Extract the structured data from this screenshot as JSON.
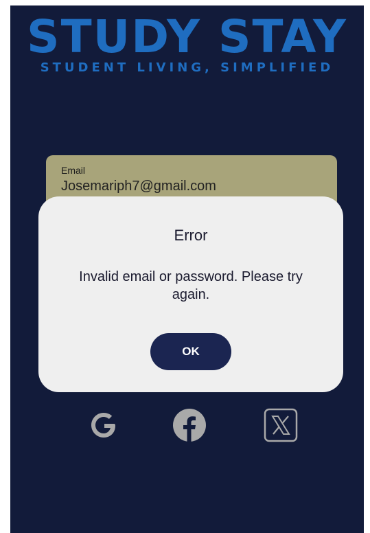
{
  "brand": {
    "title": "STUDY STAY",
    "tagline": "STUDENT LIVING, SIMPLIFIED"
  },
  "email_field": {
    "label": "Email",
    "value": "Josemariph7@gmail.com"
  },
  "dialog": {
    "title": "Error",
    "message": "Invalid email or password. Please try again.",
    "ok_label": "OK"
  },
  "social": {
    "items": [
      {
        "name": "google",
        "icon": "google-icon"
      },
      {
        "name": "facebook",
        "icon": "facebook-icon"
      },
      {
        "name": "x",
        "icon": "x-icon"
      }
    ]
  },
  "colors": {
    "background": "#121b3a",
    "brand_blue": "#1f6dc0",
    "field_bg": "#a8a47a",
    "dialog_bg": "#efefef",
    "button_bg": "#1b2551",
    "icon_gray": "#a9a9a9"
  }
}
